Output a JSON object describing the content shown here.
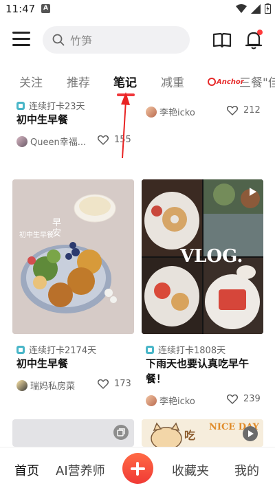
{
  "status_bar": {
    "time": "11:47",
    "badge": "A"
  },
  "header": {
    "search_placeholder": "竹笋"
  },
  "tabs": [
    {
      "label": "关注"
    },
    {
      "label": "推荐"
    },
    {
      "label": "笔记"
    },
    {
      "label": "减重"
    },
    {
      "label": "三餐\"佳"
    }
  ],
  "brand_logo": {
    "text": "Anchor"
  },
  "cards": [
    {
      "badge": "连续打卡23天",
      "title": "初中生早餐",
      "author": "Queen幸福...",
      "likes": "155"
    },
    {
      "author": "李艳icko",
      "likes": "212"
    },
    {
      "badge": "连续打卡2174天",
      "title": "初中生早餐",
      "author": "瑞妈私房菜",
      "likes": "173",
      "image_text": {
        "caption": "初中生早餐",
        "stamp": "早安"
      }
    },
    {
      "badge": "连续打卡1808天",
      "title_line1": "下雨天也要认真吃早午",
      "title_line2": "餐！",
      "author": "李艳icko",
      "likes": "239",
      "image_text": {
        "logo": "VLOG."
      }
    },
    {},
    {
      "image_text": {
        "left": "吃",
        "right": "NICE DAY"
      }
    }
  ],
  "bottom_nav": [
    {
      "label": "首页"
    },
    {
      "label": "AI营养师"
    },
    {
      "label": "收藏夹"
    },
    {
      "label": "我的"
    }
  ],
  "colors": {
    "accent": "#f0363a",
    "plus_button": "#ff5a3d",
    "badge": "#49b6c8"
  },
  "icons": [
    "menu-icon",
    "search-icon",
    "book-icon",
    "bell-icon",
    "heart-icon",
    "checkin-icon",
    "plus-icon",
    "wifi-icon",
    "signal-icon",
    "battery-icon",
    "play-icon"
  ]
}
